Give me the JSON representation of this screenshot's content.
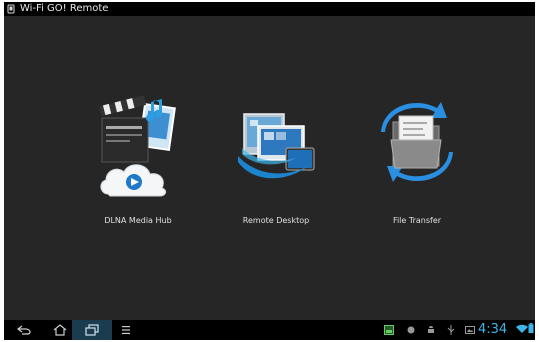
{
  "app": {
    "title": "Wi-Fi GO! Remote"
  },
  "tiles": [
    {
      "label": "DLNA Media Hub",
      "icon": "media-hub-icon"
    },
    {
      "label": "Remote Desktop",
      "icon": "remote-desktop-icon"
    },
    {
      "label": "File Transfer",
      "icon": "file-transfer-icon"
    }
  ],
  "nav": {
    "back": "back-icon",
    "home": "home-icon",
    "recent_apps": "recent-apps-icon",
    "menu": "menu-icon"
  },
  "status": {
    "time": "4:34",
    "accent_color": "#3fb4e8"
  }
}
